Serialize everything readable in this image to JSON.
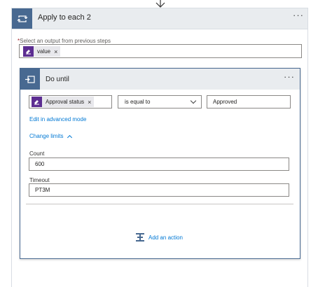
{
  "outer": {
    "title": "Apply to each 2",
    "menu": "···",
    "select_label": "Select an output from previous steps",
    "required_mark": "*",
    "token": {
      "label": "value",
      "remove": "×"
    }
  },
  "inner": {
    "title": "Do until",
    "menu": "···",
    "condition": {
      "left_token": {
        "label": "Approval status",
        "remove": "×"
      },
      "operator": "is equal to",
      "value": "Approved"
    },
    "advanced_link": "Edit in advanced mode",
    "limits_link": "Change limits",
    "count": {
      "label": "Count",
      "value": "600"
    },
    "timeout": {
      "label": "Timeout",
      "value": "PT3M"
    },
    "add_action": "Add an action"
  },
  "colors": {
    "header_accent": "#486991",
    "token_icon": "#5c2d91",
    "link": "#0078d4"
  },
  "icons": {
    "outer": "loop-icon",
    "inner": "do-until-icon",
    "token": "approval-icon",
    "add": "add-action-icon"
  }
}
